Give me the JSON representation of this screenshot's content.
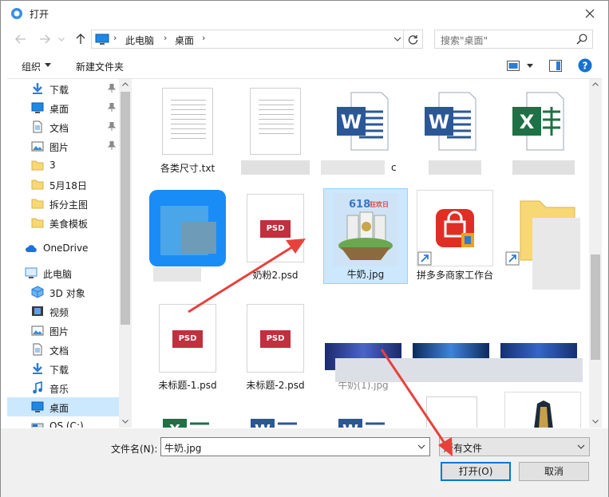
{
  "window": {
    "title": "打开"
  },
  "address": {
    "crumbs": [
      "此电脑",
      "桌面"
    ]
  },
  "search": {
    "placeholder": "搜索\"桌面\""
  },
  "toolbar": {
    "organize": "组织",
    "new_folder": "新建文件夹"
  },
  "sidebar": {
    "items": [
      {
        "label": "下载",
        "icon": "download-icon",
        "pinned": true
      },
      {
        "label": "桌面",
        "icon": "desktop-icon",
        "pinned": true
      },
      {
        "label": "文档",
        "icon": "document-icon",
        "pinned": true
      },
      {
        "label": "图片",
        "icon": "picture-icon",
        "pinned": true
      },
      {
        "label": "3",
        "icon": "folder-icon"
      },
      {
        "label": "5月18日",
        "icon": "folder-icon"
      },
      {
        "label": "拆分主图",
        "icon": "folder-icon"
      },
      {
        "label": "美食模板",
        "icon": "folder-icon"
      },
      {
        "label": "OneDrive",
        "icon": "cloud-icon"
      },
      {
        "label": "此电脑",
        "icon": "computer-icon"
      },
      {
        "label": "3D 对象",
        "icon": "3d-objects-icon"
      },
      {
        "label": "视频",
        "icon": "video-icon"
      },
      {
        "label": "图片",
        "icon": "picture-icon"
      },
      {
        "label": "文档",
        "icon": "document-icon"
      },
      {
        "label": "下载",
        "icon": "download-icon"
      },
      {
        "label": "音乐",
        "icon": "music-icon"
      },
      {
        "label": "桌面",
        "icon": "desktop-icon",
        "selected": true
      },
      {
        "label": "OS (C:)",
        "icon": "drive-icon"
      }
    ]
  },
  "files": [
    {
      "name": "各类尺寸.txt",
      "type": "txt"
    },
    {
      "name": "",
      "type": "txt"
    },
    {
      "name": "c",
      "type": "word"
    },
    {
      "name": "",
      "type": "word"
    },
    {
      "name": "",
      "type": "excel"
    },
    {
      "name": "",
      "type": "app-blue"
    },
    {
      "name": "奶粉2.psd",
      "type": "psd"
    },
    {
      "name": "牛奶.jpg",
      "type": "image",
      "selected": true
    },
    {
      "name": "拼多多商家工作台",
      "type": "pdd"
    },
    {
      "name": "",
      "type": "folder"
    },
    {
      "name": "未标题-1.psd",
      "type": "psd"
    },
    {
      "name": "未标题-2.psd",
      "type": "psd"
    },
    {
      "name": "牛奶(1).jpg",
      "type": "screenshot"
    },
    {
      "name": "",
      "type": "screenshot"
    },
    {
      "name": "",
      "type": "screenshot"
    }
  ],
  "footer": {
    "filename_label": "文件名(N):",
    "filename_value": "牛奶.jpg",
    "filter_value": "所有文件",
    "open_button": "打开(O)",
    "cancel_button": "取消"
  },
  "thumb_text": {
    "banner": "618",
    "banner2": "狂欢日"
  },
  "colors": {
    "selection": "#cce8ff",
    "accent": "#0078d7",
    "annotation": "#e8413c",
    "psd": "#c0303e",
    "word": "#2b5797",
    "excel": "#1e7145"
  }
}
